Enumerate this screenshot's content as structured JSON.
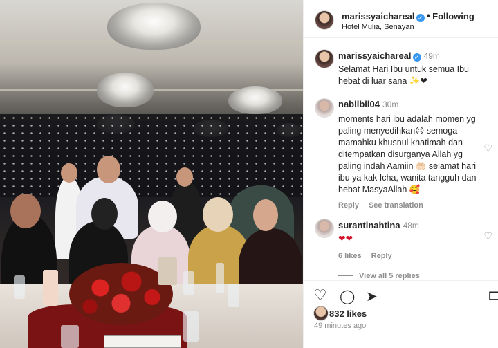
{
  "header": {
    "username": "marissyaichareal",
    "verified_glyph": "✓",
    "separator": "•",
    "follow_status": "Following",
    "location": "Hotel Mulia, Senayan",
    "more_glyph": "···"
  },
  "caption": {
    "username": "marissyaichareal",
    "time": "49m",
    "text": "Selamat Hari Ibu untuk semua Ibu hebat di luar sana ✨❤"
  },
  "comments": [
    {
      "username": "nabilbil04",
      "time": "30m",
      "text": "moments hari ibu adalah momen yg paling menyedihkan😣 semoga mamahku khusnul khatimah dan ditempatkan disurganya Allah yg paling indah Aamiin 🤲🏻 selamat hari ibu ya kak Icha, wanita tangguh dan hebat MasyaAllah 🥰",
      "reply_label": "Reply",
      "translate_label": "See translation"
    },
    {
      "username": "surantinahtina",
      "time": "48m",
      "text": "❤❤",
      "likes_label": "6 likes",
      "reply_label": "Reply",
      "view_replies_label": "View all 5 replies"
    }
  ],
  "actions": {
    "likes_count": "832 likes",
    "posted_ago": "49 minutes ago"
  },
  "icons": {
    "heart": "♡",
    "comment": "◯",
    "share": "➤",
    "save": "⊏"
  },
  "colors": {
    "verified_blue": "#3897f0",
    "muted_text": "#8e8e8e",
    "text": "#262626"
  }
}
